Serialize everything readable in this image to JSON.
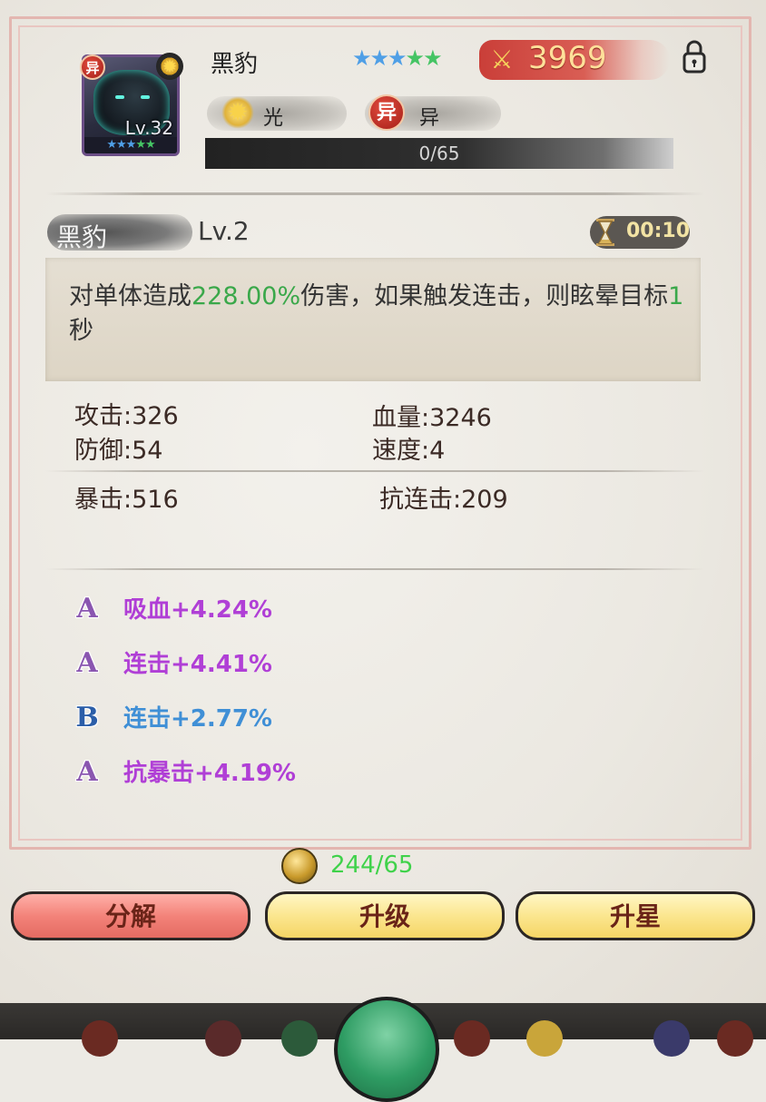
{
  "character": {
    "name": "黑豹",
    "level_label": "Lv.32",
    "stars": [
      "blue",
      "blue",
      "blue",
      "green",
      "green"
    ],
    "power": "3969",
    "element_label": "光",
    "faction_label": "异",
    "faction_badge": "异",
    "exp_text": "0/65",
    "exp_fraction": 0
  },
  "skill": {
    "name": "黑豹",
    "level": "Lv.2",
    "cooldown": "00:10",
    "desc_part1": "对单体造成",
    "desc_highlight1": "228.00%",
    "desc_part2": "伤害，如果触发连击，则眩晕目标",
    "desc_highlight2": "1",
    "desc_part3": "秒"
  },
  "stats": {
    "attack": "攻击:326",
    "hp": "血量:3246",
    "defense": "防御:54",
    "speed": "速度:4",
    "crit": "暴击:516",
    "anti_combo": "抗连击:209"
  },
  "attributes": [
    {
      "grade": "A",
      "text": "吸血+4.24%",
      "color": "#b03fd6"
    },
    {
      "grade": "A",
      "text": "连击+4.41%",
      "color": "#b03fd6"
    },
    {
      "grade": "B",
      "text": "连击+2.77%",
      "color": "#3f8fd6"
    },
    {
      "grade": "A",
      "text": "抗暴击+4.19%",
      "color": "#b03fd6"
    }
  ],
  "cost": {
    "text": "244/65"
  },
  "buttons": {
    "decompose": "分解",
    "upgrade": "升级",
    "star_up": "升星"
  },
  "colors": {
    "grade_a": "#8a56b0",
    "grade_b": "#2b5ea8",
    "highlight_green": "#3aa84a"
  }
}
